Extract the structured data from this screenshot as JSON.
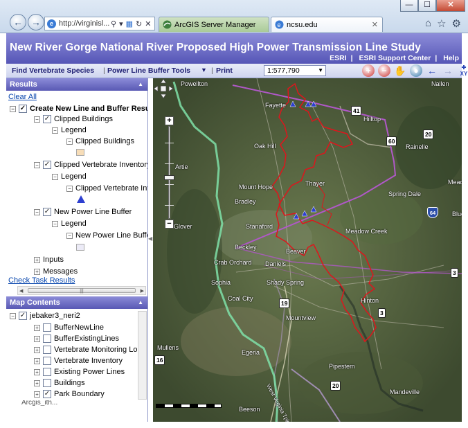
{
  "browser": {
    "url": "http://virginisl...",
    "tabs": [
      {
        "label": "ArcGIS Server Manager"
      },
      {
        "label": "ncsu.edu"
      }
    ],
    "controls": {
      "minimize": "—",
      "maximize": "☐",
      "close": "✕"
    }
  },
  "app": {
    "title": "New River Gorge National River Proposed High Power Transmission Line Study",
    "links": [
      "ESRI",
      "ESRI Support Center",
      "Help"
    ]
  },
  "toolbar": {
    "find_vertebrate": "Find Vertebrate Species",
    "buffer_tools": "Power Line Buffer Tools",
    "print": "Print",
    "scale_value": "1:577,790"
  },
  "results": {
    "header": "Results",
    "clear_all": "Clear All",
    "root": "Create New Line and Buffer Resu",
    "groups": [
      {
        "label": "Clipped Buildings",
        "legend": "Legend",
        "item": "Clipped Buildings",
        "swatch_color": "#f7ddb8"
      },
      {
        "label": "Clipped Vertebrate Inventory",
        "legend": "Legend",
        "item": "Clipped Vertebrate Inv",
        "symbol_color": "#2d3fd0"
      },
      {
        "label": "New Power Line Buffer",
        "legend": "Legend",
        "item": "New Power Line Buffer",
        "swatch_color": "#ecebf7"
      }
    ],
    "inputs": "Inputs",
    "messages": "Messages",
    "check_task": "Check Task Results"
  },
  "map_contents": {
    "header": "Map Contents",
    "service": "jebaker3_neri2",
    "layers": [
      {
        "label": "BufferNewLine",
        "checked": false
      },
      {
        "label": "BufferExistingLines",
        "checked": false
      },
      {
        "label": "Vertebrate Monitoring Loca",
        "checked": false
      },
      {
        "label": "Vertebrate Inventory",
        "checked": false
      },
      {
        "label": "Existing Power Lines",
        "checked": false
      },
      {
        "label": "Buildings",
        "checked": false
      },
      {
        "label": "Park Boundary",
        "checked": true
      }
    ],
    "truncated_next": "Arcgis_ith..."
  },
  "map": {
    "places": [
      "Powellton",
      "Fayette",
      "Hilltop",
      "Nallen",
      "Rainelle",
      "Oak Hill",
      "Thayer",
      "Mount Hope",
      "Bradley",
      "Stanaford",
      "Spring Dale",
      "Meadow Creek",
      "Beckley",
      "Beaver",
      "Daniels",
      "Crab Orchard",
      "Sophia",
      "Shady Spring",
      "Coal City",
      "Hinton",
      "Mountview",
      "Egeria",
      "Mullens",
      "Pipestem",
      "Mandeville",
      "Beeson",
      "Artie",
      "Glover",
      "Meadow",
      "Blue"
    ],
    "route_shields": [
      "41",
      "60",
      "20",
      "19",
      "3",
      "16",
      "20",
      "3"
    ],
    "interstate": "64",
    "road_label": "West Virginia Tpke",
    "colors": {
      "park_boundary": "#e0141c",
      "power_line": "#b058c8",
      "river": "#7fe0a8",
      "species_marker": "#2d3fd0"
    }
  }
}
